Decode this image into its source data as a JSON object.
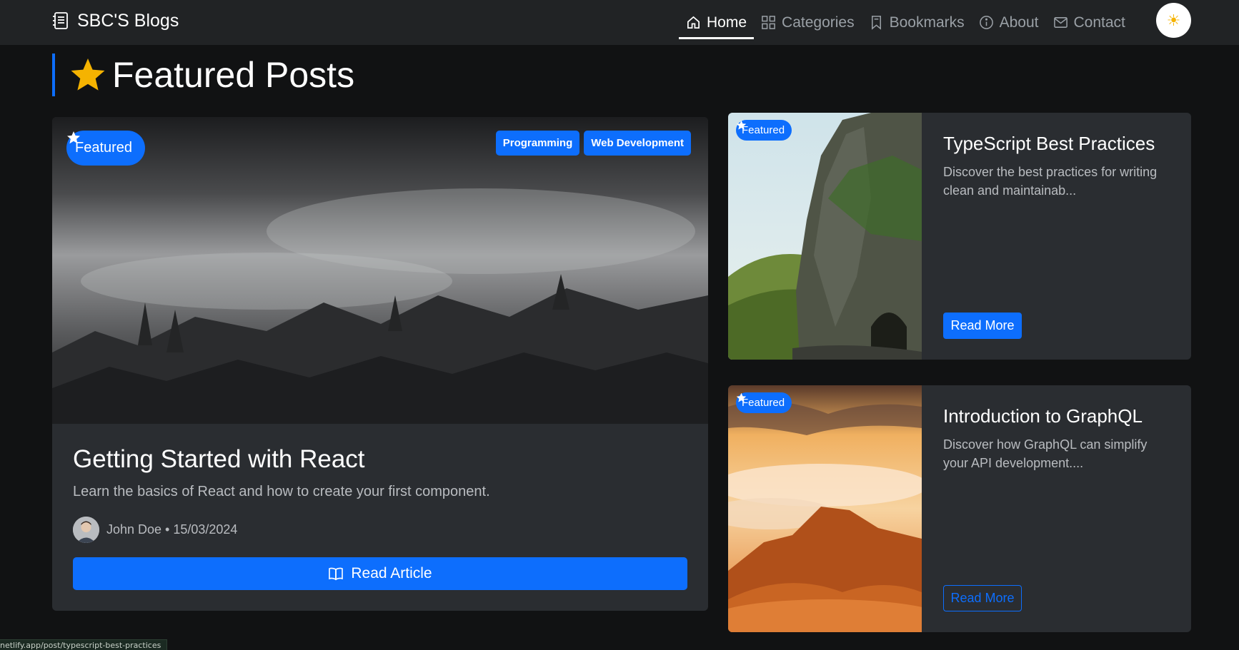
{
  "navbar": {
    "brand": "SBC'S Blogs",
    "items": [
      {
        "label": "Home",
        "icon": "home-icon",
        "active": true
      },
      {
        "label": "Categories",
        "icon": "grid-icon",
        "active": false
      },
      {
        "label": "Bookmarks",
        "icon": "bookmark-icon",
        "active": false
      },
      {
        "label": "About",
        "icon": "info-icon",
        "active": false
      },
      {
        "label": "Contact",
        "icon": "envelope-icon",
        "active": false
      }
    ],
    "theme_toggle": "☀"
  },
  "section": {
    "title": "Featured Posts"
  },
  "main_post": {
    "badge": "Featured",
    "tags": [
      "Programming",
      "Web Development"
    ],
    "title": "Getting Started with React",
    "description": "Learn the basics of React and how to create your first component.",
    "author": "John Doe",
    "date": "15/03/2024",
    "author_line": "John Doe • 15/03/2024",
    "button": "Read Article"
  },
  "side_posts": [
    {
      "badge": "Featured",
      "title": "TypeScript Best Practices",
      "description": "Discover the best practices for writing clean and maintainab...",
      "button": "Read More"
    },
    {
      "badge": "Featured",
      "title": "Introduction to GraphQL",
      "description": "Discover how GraphQL can simplify your API development....",
      "button": "Read More"
    }
  ],
  "status_url": "netlify.app/post/typescript-best-practices",
  "colors": {
    "accent": "#0d6efd",
    "background": "#111213",
    "navbar": "#212325",
    "card": "#2a2d31",
    "star": "#f5b301"
  }
}
